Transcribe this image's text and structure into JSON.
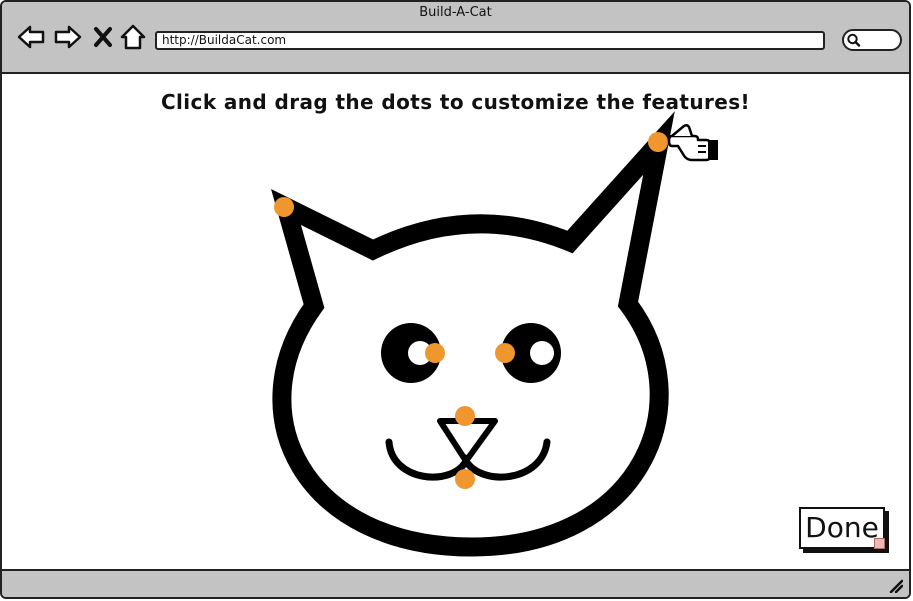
{
  "window": {
    "title": "Build-A-Cat"
  },
  "toolbar": {
    "back_icon": "back-arrow-icon",
    "forward_icon": "forward-arrow-icon",
    "stop_icon": "close-icon",
    "home_icon": "home-icon",
    "search_icon": "search-icon"
  },
  "address_bar": {
    "url": "http://BuildaCat.com"
  },
  "content": {
    "instruction": "Click and drag the dots to customize the features!",
    "done_label": "Done",
    "cursor_icon": "pointing-hand-icon"
  },
  "colors": {
    "chrome_bg": "#c3c3c3",
    "handle_dot": "#f0962f",
    "stroke": "#000000"
  },
  "handles": [
    "left-ear-tip",
    "right-ear-tip",
    "left-eye",
    "right-eye",
    "nose-top",
    "mouth-center"
  ]
}
